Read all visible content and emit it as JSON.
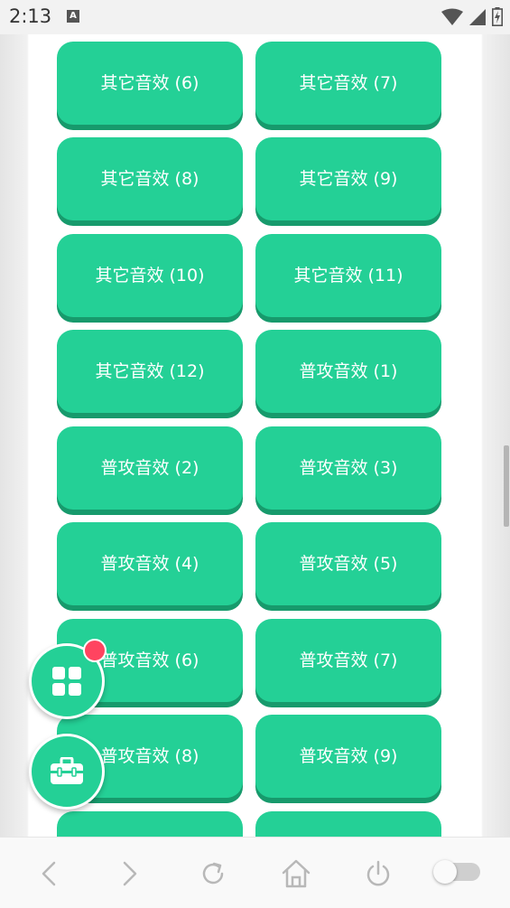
{
  "status": {
    "time": "2:13",
    "a_label": "A"
  },
  "sound_buttons": [
    {
      "label": ""
    },
    {
      "label": ""
    },
    {
      "label": "其它音效 (6)"
    },
    {
      "label": "其它音效 (7)"
    },
    {
      "label": "其它音效 (8)"
    },
    {
      "label": "其它音效 (9)"
    },
    {
      "label": "其它音效 (10)"
    },
    {
      "label": "其它音效 (11)"
    },
    {
      "label": "其它音效 (12)"
    },
    {
      "label": "普攻音效 (1)"
    },
    {
      "label": "普攻音效 (2)"
    },
    {
      "label": "普攻音效 (3)"
    },
    {
      "label": "普攻音效 (4)"
    },
    {
      "label": "普攻音效 (5)"
    },
    {
      "label": "普攻音效 (6)"
    },
    {
      "label": "普攻音效 (7)"
    },
    {
      "label": "普攻音效 (8)"
    },
    {
      "label": "普攻音效 (9)"
    },
    {
      "label": ""
    },
    {
      "label": ""
    }
  ],
  "floating": {
    "menu_icon": "grid-icon",
    "toolbox_icon": "toolbox-icon",
    "has_notification": true
  },
  "nav": {
    "icons": [
      "back-icon",
      "forward-icon",
      "refresh-icon",
      "home-icon",
      "power-icon",
      "toggle-switch"
    ]
  },
  "colors": {
    "button_green": "#24d096",
    "button_shadow": "#179a6c",
    "badge_red": "#ff4460"
  }
}
